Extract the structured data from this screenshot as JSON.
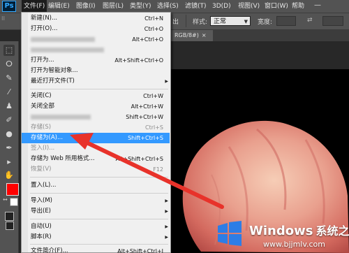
{
  "app": {
    "logo": "Ps"
  },
  "menubar": {
    "items": [
      "文件(F)",
      "编辑(E)",
      "图像(I)",
      "图层(L)",
      "类型(Y)",
      "选择(S)",
      "滤镜(T)",
      "3D(D)",
      "视图(V)",
      "窗口(W)",
      "帮助"
    ],
    "active": "文件(F)"
  },
  "options": {
    "partial_label": "出",
    "style_label": "样式:",
    "style_value": "正常",
    "width_label": "宽度:"
  },
  "tab": {
    "label": "RGB/8#)",
    "close": "×"
  },
  "file_menu": {
    "items": [
      {
        "label": "新建(N)...",
        "shortcut": "Ctrl+N"
      },
      {
        "label": "打开(O)...",
        "shortcut": "Ctrl+O"
      },
      {
        "label": "",
        "shortcut": "Alt+Ctrl+O",
        "blurred": true
      },
      {
        "label": "",
        "shortcut": "",
        "blurred": true
      },
      {
        "label": "打开为...",
        "shortcut": "Alt+Shift+Ctrl+O"
      },
      {
        "label": "打开为智能对象...",
        "shortcut": ""
      },
      {
        "label": "最近打开文件(T)",
        "shortcut": "",
        "submenu": true
      },
      {
        "label": "关闭(C)",
        "shortcut": "Ctrl+W"
      },
      {
        "label": "关闭全部",
        "shortcut": "Alt+Ctrl+W"
      },
      {
        "label": "",
        "shortcut": "Shift+Ctrl+W",
        "blurred": true
      },
      {
        "label": "存储(S)",
        "shortcut": "Ctrl+S",
        "disabled": true
      },
      {
        "label": "存储为(A)...",
        "shortcut": "Shift+Ctrl+S",
        "highlighted": true
      },
      {
        "label": "签入(I)...",
        "shortcut": "",
        "disabled": true
      },
      {
        "label": "存储为 Web 所用格式...",
        "shortcut": "Alt+Shift+Ctrl+S"
      },
      {
        "label": "恢复(V)",
        "shortcut": "F12",
        "disabled": true
      },
      {
        "label": "置入(L)...",
        "shortcut": ""
      },
      {
        "label": "导入(M)",
        "shortcut": "",
        "submenu": true
      },
      {
        "label": "导出(E)",
        "shortcut": "",
        "submenu": true
      },
      {
        "label": "自动(U)",
        "shortcut": "",
        "submenu": true
      },
      {
        "label": "脚本(R)",
        "shortcut": "",
        "submenu": true
      },
      {
        "label": "文件简介(F)...",
        "shortcut": "Alt+Shift+Ctrl+I"
      }
    ]
  },
  "colors": {
    "foreground": "#ff0000",
    "background": "#ffffff",
    "highlight": "#3399ff",
    "arrow": "#e8322a"
  },
  "watermark": {
    "title": "Windows",
    "title_cn": "系统之家",
    "url": "www.bjjmlv.com"
  }
}
